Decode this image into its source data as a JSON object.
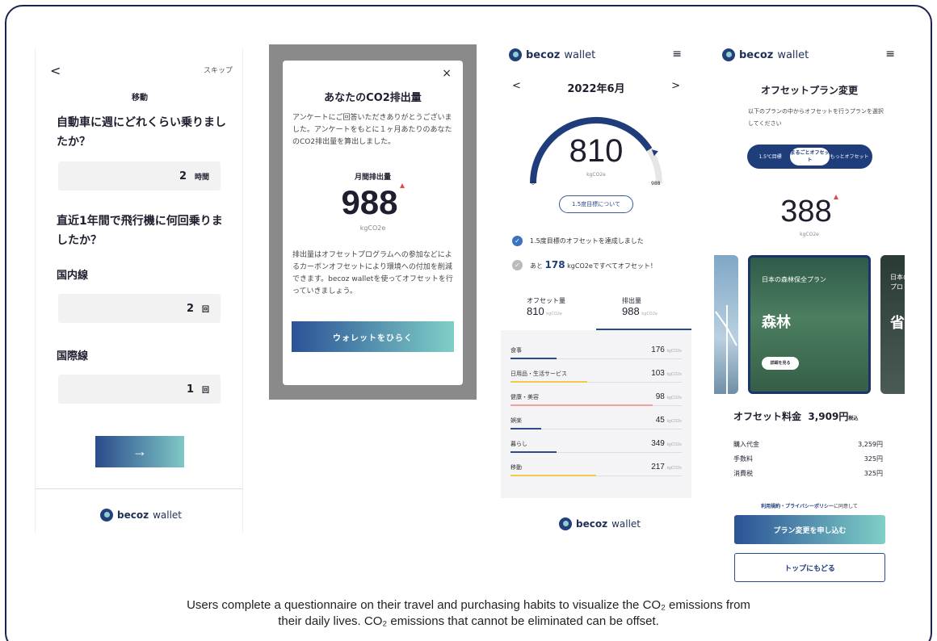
{
  "colors": {
    "navy": "#1f3d7a",
    "teal": "#7fcfc7",
    "frame": "#1d2150"
  },
  "screen1": {
    "back": "<",
    "skip": "スキップ",
    "category": "移動",
    "q1": "自動車に週にどれくらい乗りましたか？",
    "car_value": "2",
    "car_unit": "時間",
    "q2": "直近1年間で飛行機に何回乗りましたか？",
    "domestic_label": "国内線",
    "domestic_value": "2",
    "domestic_unit": "回",
    "intl_label": "国際線",
    "intl_value": "1",
    "intl_unit": "回",
    "next": "→",
    "logo_bold": "becoz",
    "logo_rest": "wallet"
  },
  "screen2": {
    "close": "×",
    "title": "あなたのCO2排出量",
    "intro": "アンケートにご回答いただきありがとうございました。アンケートをもとに１ヶ月あたりのあなたのCO2排出量を算出しました。",
    "monthly_label": "月間排出量",
    "value": "988",
    "unit": "kgCO2e",
    "note": "排出量はオフセットプログラムへの参加などによるカーボンオフセットにより環境への付加を削減できます。becoz walletを使ってオフセットを行っていきましょう。",
    "button": "ウォレットをひらく"
  },
  "screen3": {
    "logo_bold": "becoz",
    "logo_rest": "wallet",
    "menu": "≡",
    "prev": "<",
    "month": "2022年6月",
    "next": ">",
    "gauge": {
      "value": "810",
      "unit": "kgCO2e",
      "min": "0",
      "max": "988",
      "fraction": 0.82
    },
    "pill": "1.5度目標について",
    "check1": "1.5度目標のオフセットを達成しました",
    "check2_pre": "あと",
    "check2_num": "178",
    "check2_post": "kgCO2eですべてオフセット！",
    "tab_offset_label": "オフセット量",
    "tab_offset_value": "810",
    "tab_emission_label": "排出量",
    "tab_emission_value": "988",
    "tab_unit": "kgCO2e",
    "categories": [
      {
        "name": "食事",
        "value": "176",
        "color": "#2a4b8c",
        "fraction": 0.27
      },
      {
        "name": "日用品・生活サービス",
        "value": "103",
        "color": "#f2c94c",
        "fraction": 0.45
      },
      {
        "name": "健康・美容",
        "value": "98",
        "color": "#f0a2a2",
        "fraction": 0.83
      },
      {
        "name": "娯楽",
        "value": "45",
        "color": "#2a4b8c",
        "fraction": 0.18
      },
      {
        "name": "暮らし",
        "value": "349",
        "color": "#2a4b8c",
        "fraction": 0.27
      },
      {
        "name": "移動",
        "value": "217",
        "color": "#f2c94c",
        "fraction": 0.5
      }
    ],
    "cat_unit": "kgCO2e",
    "footer_logo_bold": "becoz",
    "footer_logo_rest": "wallet"
  },
  "screen4": {
    "logo_bold": "becoz",
    "logo_rest": "wallet",
    "menu": "≡",
    "title": "オフセットプラン変更",
    "subtitle": "以下のプランの中からオフセットを行うプランを選択してください",
    "seg": [
      "1.5℃目標",
      "まるごとオフセット",
      "もっとオフセット"
    ],
    "value": "388",
    "unit": "kgCO2e",
    "card_main_small": "日本の森林保全プラン",
    "card_main_large": "森林",
    "card_main_btn": "詳細を見る",
    "card_right_small": "日本の\nプロ",
    "card_right_large": "省",
    "fee_label": "オフセット料金",
    "fee_value": "3,909円",
    "fee_tax": "税込",
    "rows": [
      {
        "label": "購入代金",
        "value": "3,259円"
      },
      {
        "label": "手数料",
        "value": "325円"
      },
      {
        "label": "消費税",
        "value": "325円"
      }
    ],
    "agree_link": "利用規約・プライバシーポリシー",
    "agree_rest": "に同意して",
    "apply": "プラン変更を申し込む",
    "top": "トップにもどる"
  },
  "caption_line1": "Users complete a questionnaire on their travel and purchasing habits to visualize the CO₂ emissions from",
  "caption_line2": "their daily lives. CO₂ emissions that cannot be eliminated can be offset."
}
